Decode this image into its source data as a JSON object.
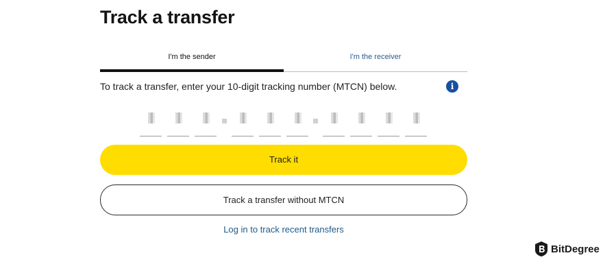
{
  "page": {
    "title": "Track a transfer"
  },
  "tabs": [
    {
      "label": "I'm the sender",
      "active": true
    },
    {
      "label": "I'm the receiver",
      "active": false
    }
  ],
  "instructions": "To track a transfer, enter your 10-digit tracking number (MTCN) below.",
  "info_icon": {
    "name": "info-icon",
    "glyph": "i"
  },
  "mtcn": {
    "digit_count": 10,
    "values_obscured": true
  },
  "buttons": {
    "track_it": "Track it",
    "track_without_mtcn": "Track a transfer without MTCN"
  },
  "links": {
    "login": "Log in to track recent transfers"
  },
  "watermark": {
    "text": "BitDegree"
  },
  "colors": {
    "accent_yellow": "#ffdd00",
    "link_blue": "#1d5a8a",
    "info_blue": "#1a4fa0"
  }
}
